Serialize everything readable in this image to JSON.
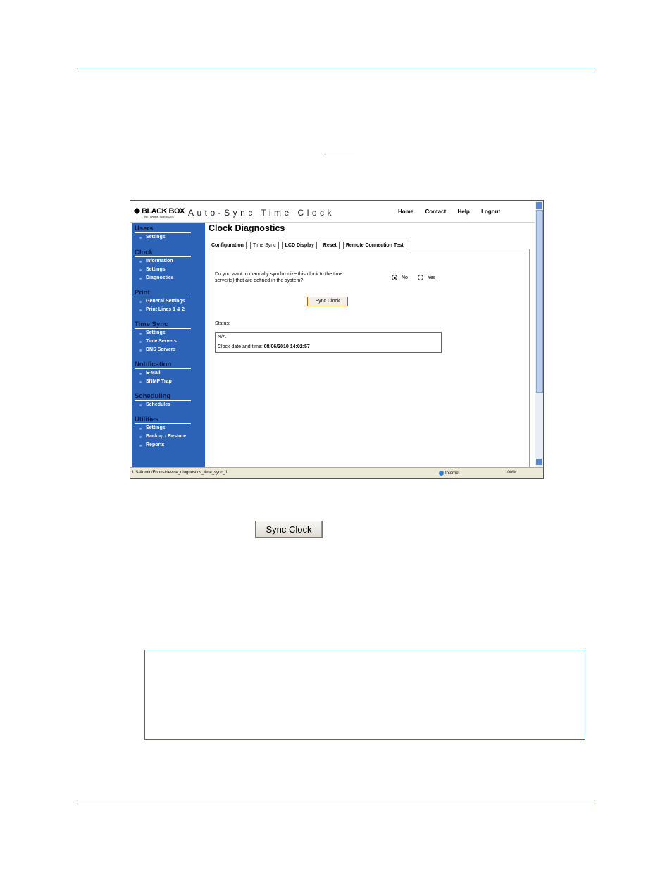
{
  "header": {
    "logo": "BLACK BOX",
    "logo_sub": "NETWORK SERVICES",
    "app_title": "Auto-Sync Time Clock",
    "nav": [
      "Home",
      "Contact",
      "Help",
      "Logout"
    ]
  },
  "sidebar": {
    "sections": [
      {
        "title": "Users",
        "items": [
          "Settings"
        ]
      },
      {
        "title": "Clock",
        "items": [
          "Information",
          "Settings",
          "Diagnostics"
        ]
      },
      {
        "title": "Print",
        "items": [
          "General Settings",
          "Print Lines 1 & 2"
        ]
      },
      {
        "title": "Time Sync",
        "items": [
          "Settings",
          "Time Servers",
          "DNS Servers"
        ]
      },
      {
        "title": "Notification",
        "items": [
          "E-Mail",
          "SNMP Trap"
        ]
      },
      {
        "title": "Scheduling",
        "items": [
          "Schedules"
        ]
      },
      {
        "title": "Utilities",
        "items": [
          "Settings",
          "Backup / Restore",
          "Reports"
        ]
      }
    ]
  },
  "main": {
    "title": "Clock Diagnostics",
    "tabs": [
      "Configuration",
      "Time Sync",
      "LCD Display",
      "Reset",
      "Remote Connection Test"
    ],
    "question": "Do you want to manually synchronize this clock to the time server(s) that are defined in the system?",
    "radio_no": "No",
    "radio_yes": "Yes",
    "sync_button": "Sync Clock",
    "status_label": "Status:",
    "status_value": "N/A",
    "clock_label": "Clock date and time:",
    "clock_value": "08/06/2010 14:02:57"
  },
  "statusbar": {
    "url": "US/Admin/Forms/device_diagnostics_time_sync_1",
    "zone": "Internet",
    "zoom": "100%"
  },
  "doc": {
    "sync_button_large": "Sync Clock"
  }
}
